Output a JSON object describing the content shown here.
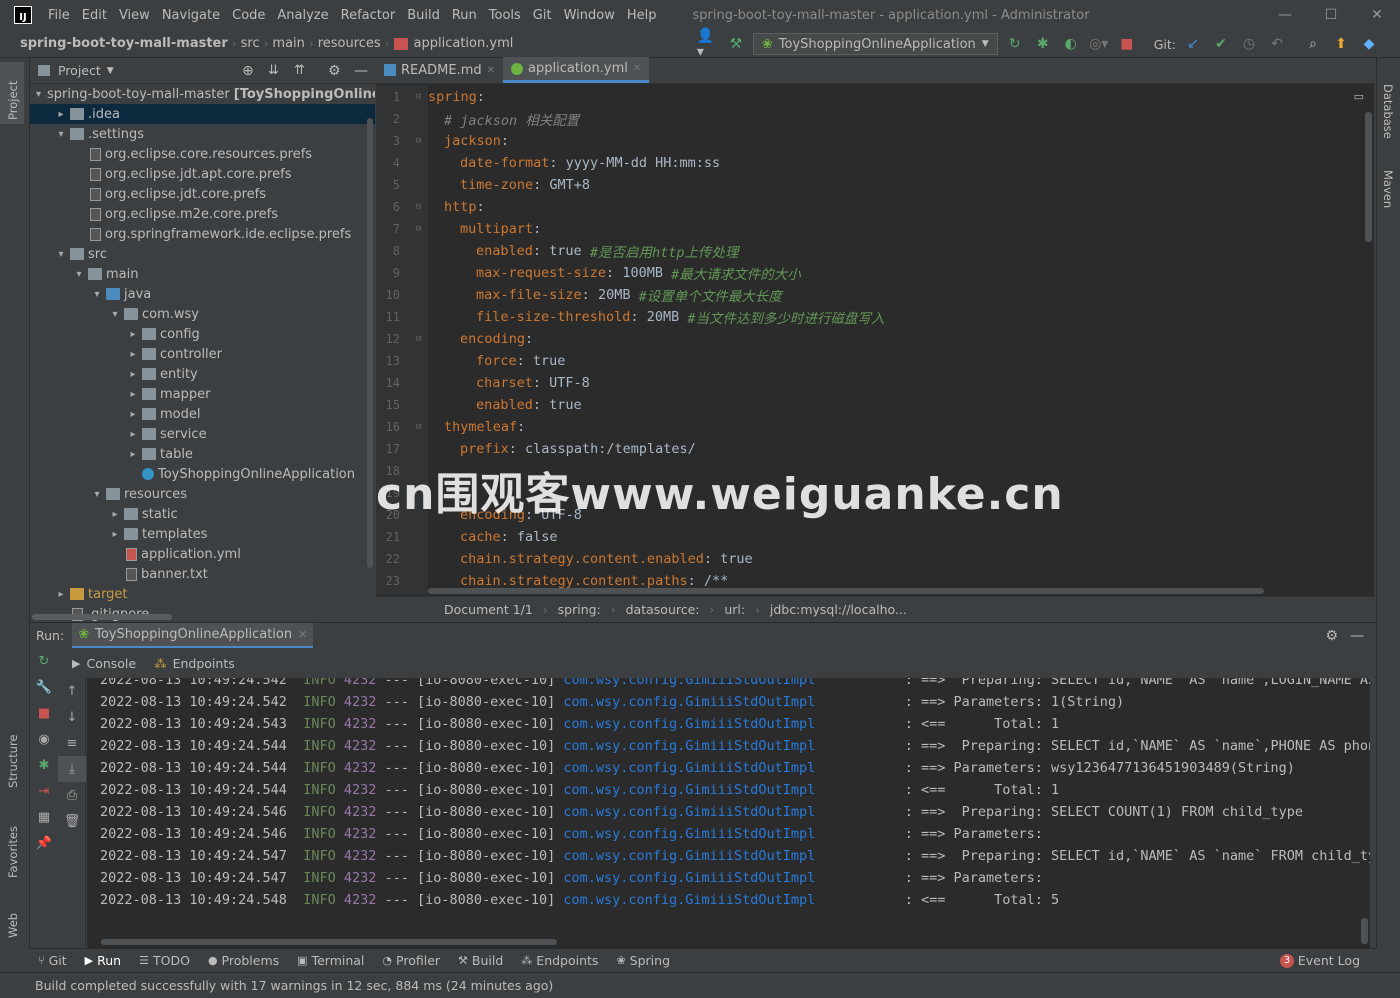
{
  "window": {
    "menu": [
      "File",
      "Edit",
      "View",
      "Navigate",
      "Code",
      "Analyze",
      "Refactor",
      "Build",
      "Run",
      "Tools",
      "Git",
      "Window",
      "Help"
    ],
    "title": "spring-boot-toy-mall-master - application.yml - Administrator",
    "controls": [
      "—",
      "☐",
      "✕"
    ]
  },
  "breadcrumb": [
    "spring-boot-toy-mall-master",
    "src",
    "main",
    "resources",
    "application.yml"
  ],
  "toolbar": {
    "run_config": "ToyShoppingOnlineApplication",
    "git_label": "Git:"
  },
  "left_stripe": {
    "project": "Project",
    "structure": "Structure",
    "favorites": "Favorites",
    "web": "Web"
  },
  "right_stripe": {
    "database": "Database",
    "maven": "Maven"
  },
  "project_panel": {
    "title": "Project",
    "tree": [
      {
        "label": "spring-boot-toy-mall-master",
        "bold_suffix": "[ToyShoppingOnline]",
        "indent": 0,
        "arrow": "▾",
        "icon": "folder",
        "selected": false
      },
      {
        "label": ".idea",
        "indent": 1,
        "arrow": "▸",
        "icon": "folder",
        "selected": true
      },
      {
        "label": ".settings",
        "indent": 1,
        "arrow": "▾",
        "icon": "folder"
      },
      {
        "label": "org.eclipse.core.resources.prefs",
        "indent": 2,
        "arrow": "",
        "icon": "file"
      },
      {
        "label": "org.eclipse.jdt.apt.core.prefs",
        "indent": 2,
        "arrow": "",
        "icon": "file"
      },
      {
        "label": "org.eclipse.jdt.core.prefs",
        "indent": 2,
        "arrow": "",
        "icon": "file"
      },
      {
        "label": "org.eclipse.m2e.core.prefs",
        "indent": 2,
        "arrow": "",
        "icon": "file"
      },
      {
        "label": "org.springframework.ide.eclipse.prefs",
        "indent": 2,
        "arrow": "",
        "icon": "file"
      },
      {
        "label": "src",
        "indent": 1,
        "arrow": "▾",
        "icon": "folder"
      },
      {
        "label": "main",
        "indent": 2,
        "arrow": "▾",
        "icon": "folder"
      },
      {
        "label": "java",
        "indent": 3,
        "arrow": "▾",
        "icon": "folder-blue"
      },
      {
        "label": "com.wsy",
        "indent": 4,
        "arrow": "▾",
        "icon": "folder"
      },
      {
        "label": "config",
        "indent": 5,
        "arrow": "▸",
        "icon": "folder"
      },
      {
        "label": "controller",
        "indent": 5,
        "arrow": "▸",
        "icon": "folder"
      },
      {
        "label": "entity",
        "indent": 5,
        "arrow": "▸",
        "icon": "folder"
      },
      {
        "label": "mapper",
        "indent": 5,
        "arrow": "▸",
        "icon": "folder"
      },
      {
        "label": "model",
        "indent": 5,
        "arrow": "▸",
        "icon": "folder"
      },
      {
        "label": "service",
        "indent": 5,
        "arrow": "▸",
        "icon": "folder"
      },
      {
        "label": "table",
        "indent": 5,
        "arrow": "▸",
        "icon": "folder"
      },
      {
        "label": "ToyShoppingOnlineApplication",
        "indent": 5,
        "arrow": "",
        "icon": "spring-class"
      },
      {
        "label": "resources",
        "indent": 3,
        "arrow": "▾",
        "icon": "folder"
      },
      {
        "label": "static",
        "indent": 4,
        "arrow": "▸",
        "icon": "folder"
      },
      {
        "label": "templates",
        "indent": 4,
        "arrow": "▸",
        "icon": "folder"
      },
      {
        "label": "application.yml",
        "indent": 4,
        "arrow": "",
        "icon": "yml"
      },
      {
        "label": "banner.txt",
        "indent": 4,
        "arrow": "",
        "icon": "file"
      },
      {
        "label": "target",
        "indent": 1,
        "arrow": "▸",
        "icon": "folder-orange"
      },
      {
        "label": ".gitignore",
        "indent": 1,
        "arrow": "",
        "icon": "file"
      }
    ]
  },
  "editor": {
    "tabs": [
      {
        "label": "README.md",
        "active": false
      },
      {
        "label": "application.yml",
        "active": true
      }
    ],
    "lines": [
      {
        "no": "1",
        "indent": 0,
        "key": "spring",
        "sep": ":",
        "val": "",
        "comment": ""
      },
      {
        "no": "2",
        "indent": 1,
        "key": "",
        "sep": "",
        "val": "",
        "comment": "# jackson 相关配置"
      },
      {
        "no": "3",
        "indent": 1,
        "key": "jackson",
        "sep": ":",
        "val": "",
        "comment": ""
      },
      {
        "no": "4",
        "indent": 2,
        "key": "date-format",
        "sep": ": ",
        "val": "yyyy-MM-dd HH:mm:ss",
        "comment": ""
      },
      {
        "no": "5",
        "indent": 2,
        "key": "time-zone",
        "sep": ": ",
        "val": "GMT+8",
        "comment": ""
      },
      {
        "no": "6",
        "indent": 1,
        "key": "http",
        "sep": ":",
        "val": "",
        "comment": ""
      },
      {
        "no": "7",
        "indent": 2,
        "key": "multipart",
        "sep": ":",
        "val": "",
        "comment": ""
      },
      {
        "no": "8",
        "indent": 3,
        "key": "enabled",
        "sep": ": ",
        "val": "true ",
        "comment": "#是否启用http上传处理"
      },
      {
        "no": "9",
        "indent": 3,
        "key": "max-request-size",
        "sep": ": ",
        "val": "100MB ",
        "comment": "#最大请求文件的大小"
      },
      {
        "no": "10",
        "indent": 3,
        "key": "max-file-size",
        "sep": ": ",
        "val": "20MB ",
        "comment": "#设置单个文件最大长度"
      },
      {
        "no": "11",
        "indent": 3,
        "key": "file-size-threshold",
        "sep": ": ",
        "val": "20MB ",
        "comment": "#当文件达到多少时进行磁盘写入"
      },
      {
        "no": "12",
        "indent": 2,
        "key": "encoding",
        "sep": ":",
        "val": "",
        "comment": ""
      },
      {
        "no": "13",
        "indent": 3,
        "key": "force",
        "sep": ": ",
        "val": "true",
        "comment": ""
      },
      {
        "no": "14",
        "indent": 3,
        "key": "charset",
        "sep": ": ",
        "val": "UTF-8",
        "comment": ""
      },
      {
        "no": "15",
        "indent": 3,
        "key": "enabled",
        "sep": ": ",
        "val": "true",
        "comment": ""
      },
      {
        "no": "16",
        "indent": 1,
        "key": "thymeleaf",
        "sep": ":",
        "val": "",
        "comment": ""
      },
      {
        "no": "17",
        "indent": 2,
        "key": "prefix",
        "sep": ": ",
        "val": "classpath:/templates/",
        "comment": ""
      },
      {
        "no": "18",
        "indent": 2,
        "key": "",
        "sep": "",
        "val": "",
        "comment": ""
      },
      {
        "no": "19",
        "indent": 2,
        "key": "",
        "sep": "",
        "val": "",
        "comment": ""
      },
      {
        "no": "20",
        "indent": 2,
        "key": "encoding",
        "sep": ": ",
        "val": "UTF-8",
        "comment": ""
      },
      {
        "no": "21",
        "indent": 2,
        "key": "cache",
        "sep": ": ",
        "val": "false",
        "comment": ""
      },
      {
        "no": "22",
        "indent": 2,
        "key": "chain.strategy.content.enabled",
        "sep": ": ",
        "val": "true",
        "comment": ""
      },
      {
        "no": "23",
        "indent": 2,
        "key": "chain.strategy.content.paths",
        "sep": ": ",
        "val": "/**",
        "comment": ""
      }
    ],
    "status": [
      "Document 1/1",
      "spring:",
      "datasource:",
      "url:",
      "jdbc:mysql://localho..."
    ]
  },
  "run_panel": {
    "label": "Run:",
    "tab": "ToyShoppingOnlineApplication",
    "subtabs": [
      "Console",
      "Endpoints"
    ],
    "console": [
      {
        "ts": "2022-08-13 10:49:24.542",
        "level": "INFO",
        "pid": "4232",
        "thread": "--- [io-8080-exec-10]",
        "cls": "com.wsy.config.GimiiiStdOutImpl",
        "msg": ": ==>  Preparing: SELECT id,`NAME` AS `name`,LOGIN_NAME AS lo"
      },
      {
        "ts": "2022-08-13 10:49:24.542",
        "level": "INFO",
        "pid": "4232",
        "thread": "--- [io-8080-exec-10]",
        "cls": "com.wsy.config.GimiiiStdOutImpl",
        "msg": ": ==> Parameters: 1(String)"
      },
      {
        "ts": "2022-08-13 10:49:24.543",
        "level": "INFO",
        "pid": "4232",
        "thread": "--- [io-8080-exec-10]",
        "cls": "com.wsy.config.GimiiiStdOutImpl",
        "msg": ": <==      Total: 1"
      },
      {
        "ts": "2022-08-13 10:49:24.544",
        "level": "INFO",
        "pid": "4232",
        "thread": "--- [io-8080-exec-10]",
        "cls": "com.wsy.config.GimiiiStdOutImpl",
        "msg": ": ==>  Preparing: SELECT id,`NAME` AS `name`,PHONE AS phone,`"
      },
      {
        "ts": "2022-08-13 10:49:24.544",
        "level": "INFO",
        "pid": "4232",
        "thread": "--- [io-8080-exec-10]",
        "cls": "com.wsy.config.GimiiiStdOutImpl",
        "msg": ": ==> Parameters: wsy1236477136451903489(String)"
      },
      {
        "ts": "2022-08-13 10:49:24.544",
        "level": "INFO",
        "pid": "4232",
        "thread": "--- [io-8080-exec-10]",
        "cls": "com.wsy.config.GimiiiStdOutImpl",
        "msg": ": <==      Total: 1"
      },
      {
        "ts": "2022-08-13 10:49:24.546",
        "level": "INFO",
        "pid": "4232",
        "thread": "--- [io-8080-exec-10]",
        "cls": "com.wsy.config.GimiiiStdOutImpl",
        "msg": ": ==>  Preparing: SELECT COUNT(1) FROM child_type"
      },
      {
        "ts": "2022-08-13 10:49:24.546",
        "level": "INFO",
        "pid": "4232",
        "thread": "--- [io-8080-exec-10]",
        "cls": "com.wsy.config.GimiiiStdOutImpl",
        "msg": ": ==> Parameters: "
      },
      {
        "ts": "2022-08-13 10:49:24.547",
        "level": "INFO",
        "pid": "4232",
        "thread": "--- [io-8080-exec-10]",
        "cls": "com.wsy.config.GimiiiStdOutImpl",
        "msg": ": ==>  Preparing: SELECT id,`NAME` AS `name` FROM child_type"
      },
      {
        "ts": "2022-08-13 10:49:24.547",
        "level": "INFO",
        "pid": "4232",
        "thread": "--- [io-8080-exec-10]",
        "cls": "com.wsy.config.GimiiiStdOutImpl",
        "msg": ": ==> Parameters: "
      },
      {
        "ts": "2022-08-13 10:49:24.548",
        "level": "INFO",
        "pid": "4232",
        "thread": "--- [io-8080-exec-10]",
        "cls": "com.wsy.config.GimiiiStdOutImpl",
        "msg": ": <==      Total: 5"
      }
    ]
  },
  "bottom_tabs": [
    {
      "label": "Git",
      "icon": "⑂"
    },
    {
      "label": "Run",
      "icon": "▶",
      "active": true
    },
    {
      "label": "TODO",
      "icon": "☰"
    },
    {
      "label": "Problems",
      "icon": "●"
    },
    {
      "label": "Terminal",
      "icon": "▣"
    },
    {
      "label": "Profiler",
      "icon": "◔"
    },
    {
      "label": "Build",
      "icon": "⚒"
    },
    {
      "label": "Endpoints",
      "icon": "⁂"
    },
    {
      "label": "Spring",
      "icon": "❀"
    }
  ],
  "event_log": {
    "badge": "3",
    "label": "Event Log"
  },
  "status_text": "Build completed successfully with 17 warnings in 12 sec, 884 ms (24 minutes ago)",
  "watermark": "cn围观客www.weiguanke.cn"
}
